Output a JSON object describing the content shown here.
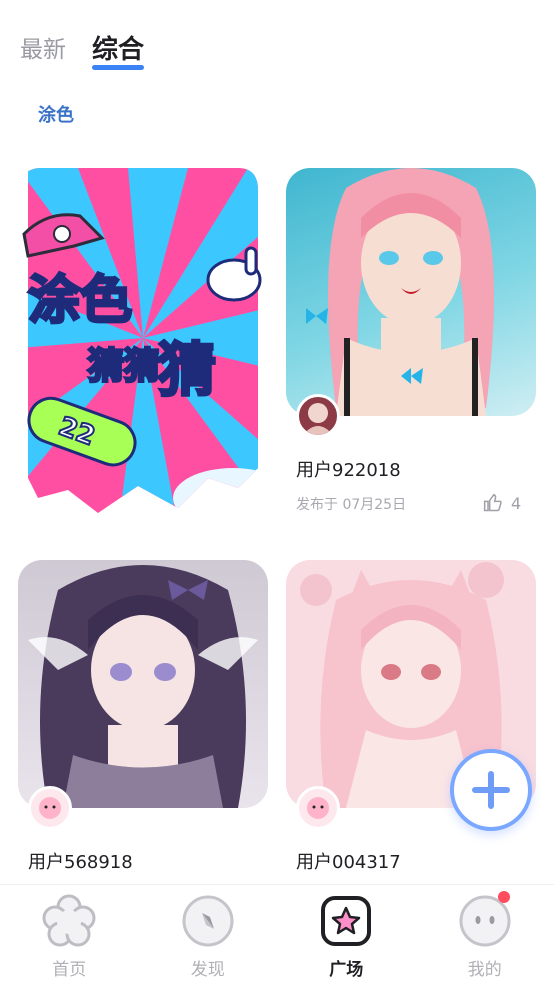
{
  "top_tabs": {
    "latest": "最新",
    "overall": "综合"
  },
  "filter": {
    "label": "涂色"
  },
  "cards": [
    {
      "poster_title": "涂色猜猜猜",
      "poster_badge": "22"
    },
    {
      "user": "用户922018",
      "date": "发布于 07月25日",
      "likes": "4"
    },
    {
      "user": "用户568918"
    },
    {
      "user": "用户004317"
    }
  ],
  "fab": {
    "icon": "plus-icon"
  },
  "bottom_nav": {
    "home": "首页",
    "discover": "发现",
    "square": "广场",
    "mine": "我的"
  },
  "colors": {
    "accent": "#3b82f6",
    "fab_border": "#7aa7ff",
    "badge": "#ff4d5e"
  }
}
